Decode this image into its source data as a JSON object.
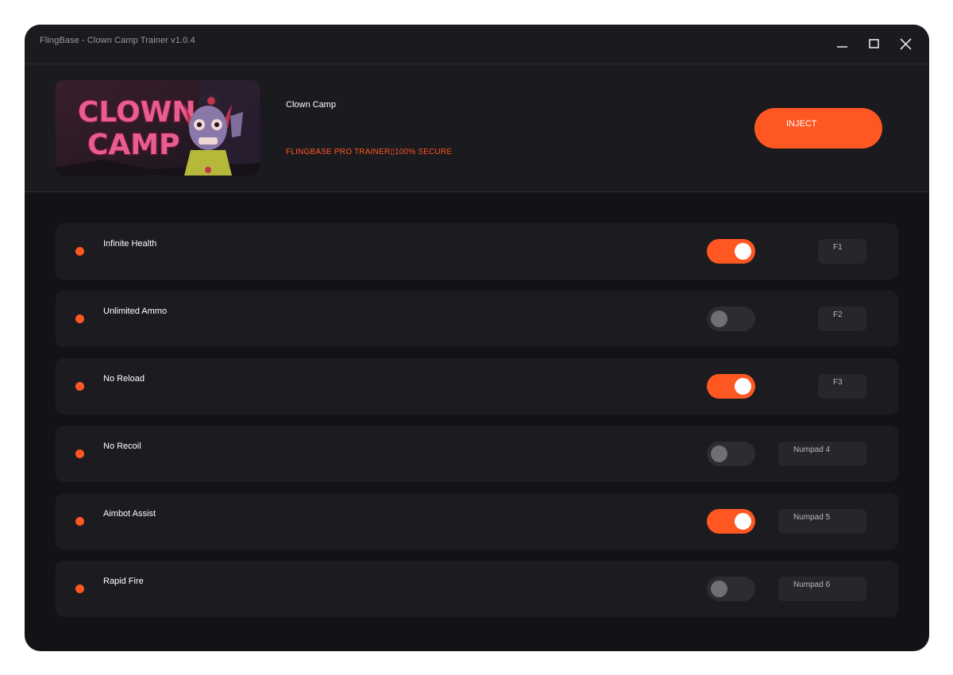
{
  "window": {
    "title": "FlingBase - Clown Camp Trainer v1.0.4"
  },
  "header": {
    "banner_text_line1": "CLOWN",
    "banner_text_line2": "CAMP",
    "game_name": "Clown Camp",
    "tagline": "FLINGBASE PRO TRAINER▯100% SECURE",
    "inject_label": "INJECT"
  },
  "colors": {
    "accent": "#ff5722",
    "background": "#131217",
    "panel": "#1b1a1f",
    "row": "#1c1b20"
  },
  "cheats": [
    {
      "label": "Infinite Health",
      "enabled": true,
      "hotkey": "F1"
    },
    {
      "label": "Unlimited Ammo",
      "enabled": false,
      "hotkey": "F2"
    },
    {
      "label": "No Reload",
      "enabled": true,
      "hotkey": "F3"
    },
    {
      "label": "No Recoil",
      "enabled": false,
      "hotkey": "Numpad 4"
    },
    {
      "label": "Aimbot Assist",
      "enabled": true,
      "hotkey": "Numpad 5"
    },
    {
      "label": "Rapid Fire",
      "enabled": false,
      "hotkey": "Numpad 6"
    }
  ]
}
